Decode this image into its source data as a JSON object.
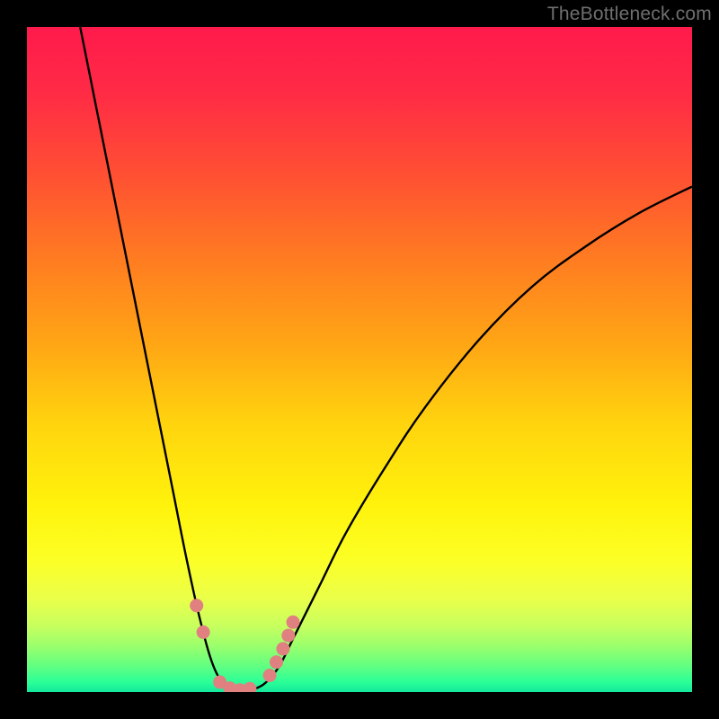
{
  "watermark": "TheBottleneck.com",
  "colors": {
    "gradient_stops": [
      {
        "offset": 0.0,
        "color": "#ff1a4c"
      },
      {
        "offset": 0.1,
        "color": "#ff2b45"
      },
      {
        "offset": 0.22,
        "color": "#ff4f33"
      },
      {
        "offset": 0.35,
        "color": "#ff7c21"
      },
      {
        "offset": 0.48,
        "color": "#ffa714"
      },
      {
        "offset": 0.6,
        "color": "#ffd50e"
      },
      {
        "offset": 0.72,
        "color": "#fff30c"
      },
      {
        "offset": 0.8,
        "color": "#fcff25"
      },
      {
        "offset": 0.86,
        "color": "#eaff4a"
      },
      {
        "offset": 0.9,
        "color": "#c8ff5e"
      },
      {
        "offset": 0.93,
        "color": "#9cff6c"
      },
      {
        "offset": 0.96,
        "color": "#63ff80"
      },
      {
        "offset": 0.985,
        "color": "#2bff97"
      },
      {
        "offset": 1.0,
        "color": "#13e89d"
      }
    ],
    "curve_stroke": "#000000",
    "marker_fill": "#e08080",
    "marker_stroke": "#e08080"
  },
  "chart_data": {
    "type": "line",
    "title": "",
    "xlabel": "",
    "ylabel": "",
    "x_range": [
      0,
      100
    ],
    "y_range": [
      0,
      100
    ],
    "curve": {
      "description": "Bottleneck percentage vs component ratio; minimum near x≈32",
      "points": [
        {
          "x": 8,
          "y": 100
        },
        {
          "x": 10,
          "y": 90
        },
        {
          "x": 12,
          "y": 80
        },
        {
          "x": 14,
          "y": 70
        },
        {
          "x": 16,
          "y": 60
        },
        {
          "x": 18,
          "y": 50
        },
        {
          "x": 20,
          "y": 40
        },
        {
          "x": 22,
          "y": 30
        },
        {
          "x": 24,
          "y": 20
        },
        {
          "x": 26,
          "y": 11
        },
        {
          "x": 28,
          "y": 4
        },
        {
          "x": 30,
          "y": 0.8
        },
        {
          "x": 32,
          "y": 0.2
        },
        {
          "x": 34,
          "y": 0.4
        },
        {
          "x": 36,
          "y": 1.5
        },
        {
          "x": 38,
          "y": 4
        },
        {
          "x": 40,
          "y": 8
        },
        {
          "x": 44,
          "y": 16
        },
        {
          "x": 48,
          "y": 24
        },
        {
          "x": 54,
          "y": 34
        },
        {
          "x": 60,
          "y": 43
        },
        {
          "x": 68,
          "y": 53
        },
        {
          "x": 76,
          "y": 61
        },
        {
          "x": 84,
          "y": 67
        },
        {
          "x": 92,
          "y": 72
        },
        {
          "x": 100,
          "y": 76
        }
      ]
    },
    "markers": [
      {
        "x": 25.5,
        "y": 13
      },
      {
        "x": 26.5,
        "y": 9
      },
      {
        "x": 29,
        "y": 1.5
      },
      {
        "x": 30.5,
        "y": 0.6
      },
      {
        "x": 32,
        "y": 0.3
      },
      {
        "x": 33.5,
        "y": 0.5
      },
      {
        "x": 36.5,
        "y": 2.5
      },
      {
        "x": 37.5,
        "y": 4.5
      },
      {
        "x": 38.5,
        "y": 6.5
      },
      {
        "x": 39.3,
        "y": 8.5
      },
      {
        "x": 40,
        "y": 10.5
      }
    ],
    "marker_radius_px": 7
  }
}
